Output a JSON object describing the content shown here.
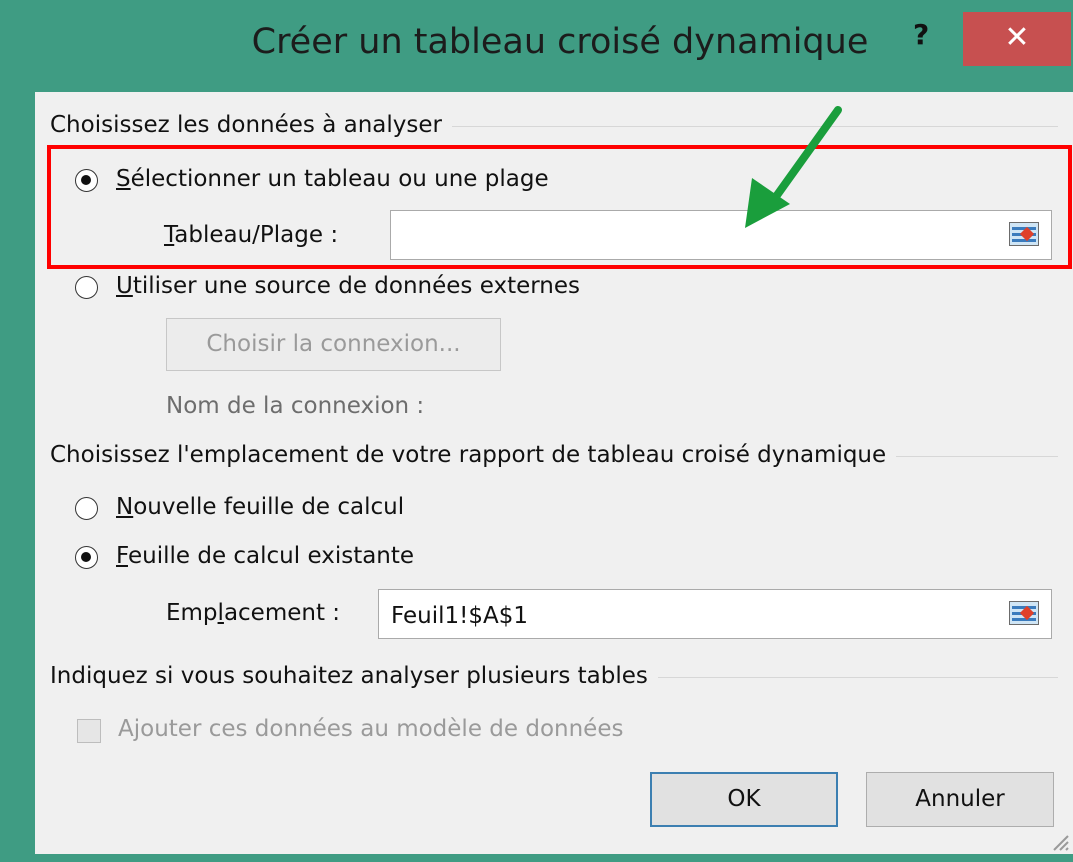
{
  "window": {
    "title": "Créer un tableau croisé dynamique",
    "help_label": "?",
    "close_label": "✕"
  },
  "data_section": {
    "title": "Choisissez les données à analyser",
    "option_table": "Sélectionner un tableau ou une plage",
    "table_range_label": "Tableau/Plage :",
    "table_range_value": "",
    "option_external": "Utiliser une source de données externes",
    "choose_connection": "Choisir la connexion...",
    "connection_name_label": "Nom de la connexion :"
  },
  "location_section": {
    "title": "Choisissez l'emplacement de votre rapport de tableau croisé dynamique",
    "option_new_sheet": "Nouvelle feuille de calcul",
    "option_existing_sheet": "Feuille de calcul existante",
    "location_label": "Emplacement :",
    "location_value": "Feuil1!$A$1"
  },
  "multi_section": {
    "title": "Indiquez si vous souhaitez analyser plusieurs tables",
    "add_to_model": "Ajouter ces données au modèle de données"
  },
  "buttons": {
    "ok": "OK",
    "cancel": "Annuler"
  },
  "state": {
    "data_source": "table_or_range",
    "report_location": "existing_sheet",
    "add_to_model_checked": false
  },
  "annotations": {
    "highlight_color": "#ff0000",
    "arrow_color": "#1a9e3c"
  },
  "colors": {
    "title_bar": "#3f9c83",
    "close_button": "#c75050",
    "dialog_background": "#f0f0f0"
  },
  "icons": [
    "help-icon",
    "close-icon",
    "range-selector-icon",
    "resize-grip-icon"
  ]
}
